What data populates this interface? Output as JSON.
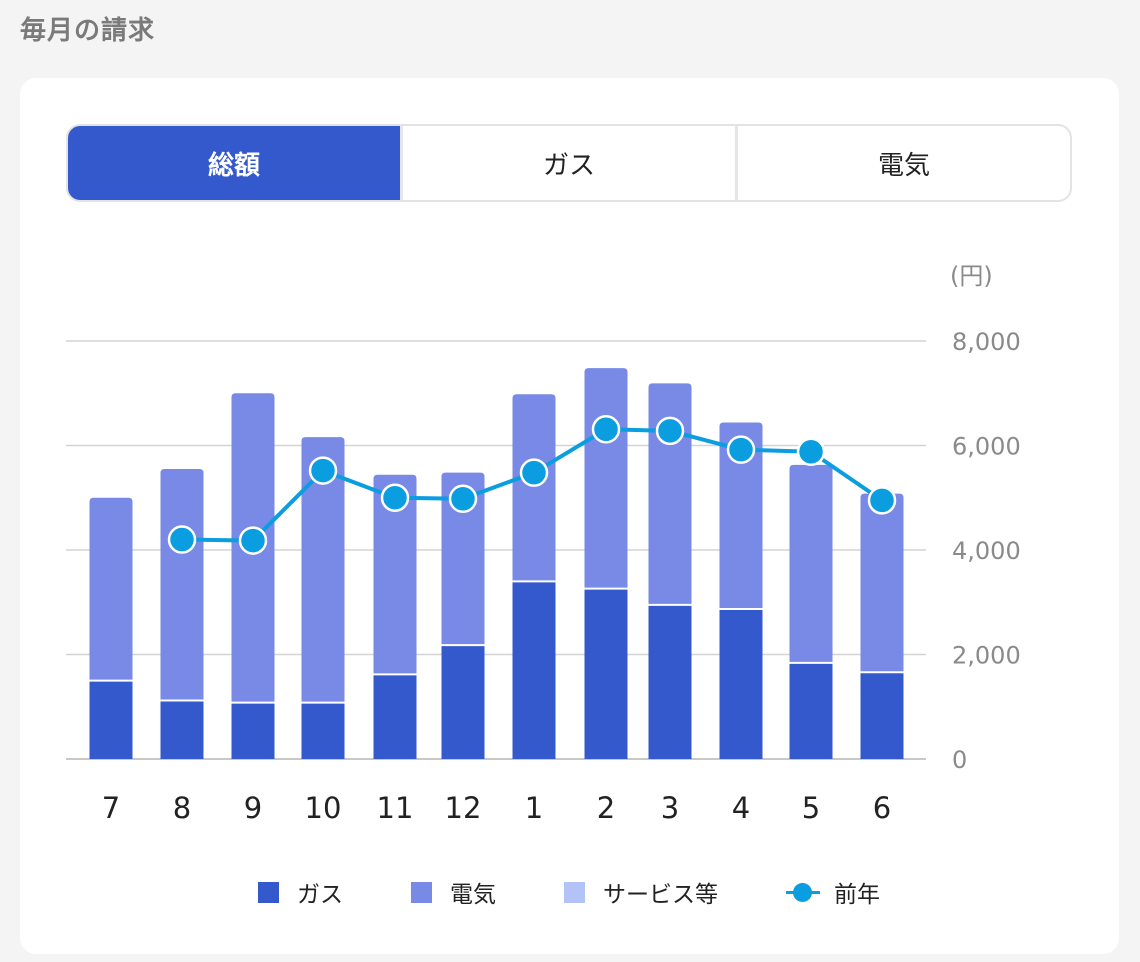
{
  "page": {
    "title": "毎月の請求"
  },
  "tabs": [
    {
      "label": "総額",
      "active": true
    },
    {
      "label": "ガス",
      "active": false
    },
    {
      "label": "電気",
      "active": false
    }
  ],
  "colors": {
    "gas": "#3459cc",
    "electric": "#7889e6",
    "services": "#b3c3f7",
    "prev_year": "#0a9de0"
  },
  "chart_data": {
    "type": "bar",
    "stacked": true,
    "unit_label": "(円)",
    "categories": [
      "7",
      "8",
      "9",
      "10",
      "11",
      "12",
      "1",
      "2",
      "3",
      "4",
      "5",
      "6"
    ],
    "series": [
      {
        "name": "ガス",
        "type": "bar",
        "values": [
          1500,
          1120,
          1080,
          1080,
          1620,
          2180,
          3400,
          3260,
          2950,
          2870,
          1840,
          1660
        ]
      },
      {
        "name": "電気",
        "type": "bar",
        "values": [
          3500,
          4430,
          5920,
          5080,
          3820,
          3300,
          3580,
          4220,
          4240,
          3570,
          3790,
          3420
        ]
      },
      {
        "name": "サービス等",
        "type": "bar",
        "values": [
          0,
          0,
          0,
          0,
          0,
          0,
          0,
          0,
          0,
          0,
          0,
          0
        ]
      },
      {
        "name": "前年",
        "type": "line",
        "values": [
          null,
          4200,
          4180,
          5520,
          5000,
          4980,
          5480,
          6310,
          6280,
          5920,
          5880,
          4950
        ]
      }
    ],
    "y_ticks": [
      "0",
      "2,000",
      "4,000",
      "6,000",
      "8,000"
    ],
    "ylim": [
      0,
      8000
    ],
    "grid": true,
    "legend": "bottom"
  }
}
